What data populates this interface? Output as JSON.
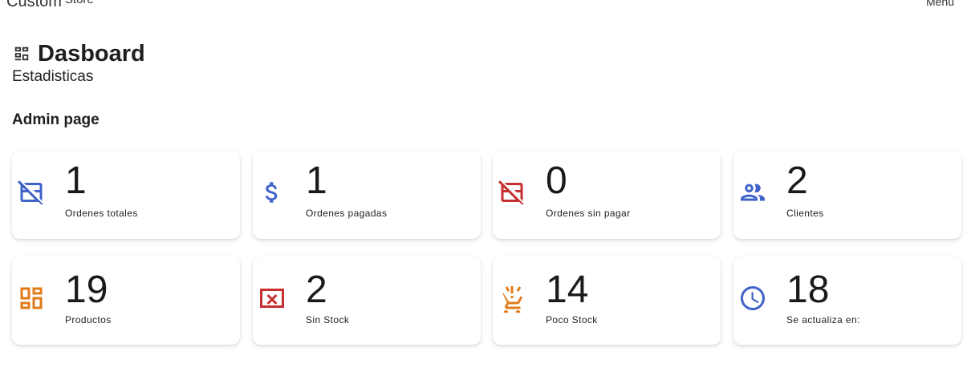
{
  "brand": {
    "name": "Custom",
    "sub": "Store"
  },
  "nav": {
    "menu_label": "Menu"
  },
  "page": {
    "title": "Dasboard",
    "subtitle": "Estadisticas",
    "section": "Admin page"
  },
  "colors": {
    "blue": "#3f63c9",
    "red": "#c62f2f",
    "orange": "#e07b1a"
  },
  "cards": [
    {
      "value": "1",
      "label": "Ordenes totales",
      "icon": "credit-card-off-icon",
      "color": "#3f63c9"
    },
    {
      "value": "1",
      "label": "Ordenes pagadas",
      "icon": "dollar-icon",
      "color": "#3f63c9"
    },
    {
      "value": "0",
      "label": "Ordenes sin pagar",
      "icon": "credit-card-off-icon",
      "color": "#c62f2f"
    },
    {
      "value": "2",
      "label": "Clientes",
      "icon": "group-icon",
      "color": "#3f63c9"
    },
    {
      "value": "19",
      "label": "Productos",
      "icon": "dashboard-icon",
      "color": "#e07b1a"
    },
    {
      "value": "2",
      "label": "Sin Stock",
      "icon": "cancel-box-icon",
      "color": "#c62f2f"
    },
    {
      "value": "14",
      "label": "Poco Stock",
      "icon": "cart-alert-icon",
      "color": "#e07b1a"
    },
    {
      "value": "18",
      "label": "Se actualiza en:",
      "icon": "clock-icon",
      "color": "#3f63c9"
    }
  ]
}
